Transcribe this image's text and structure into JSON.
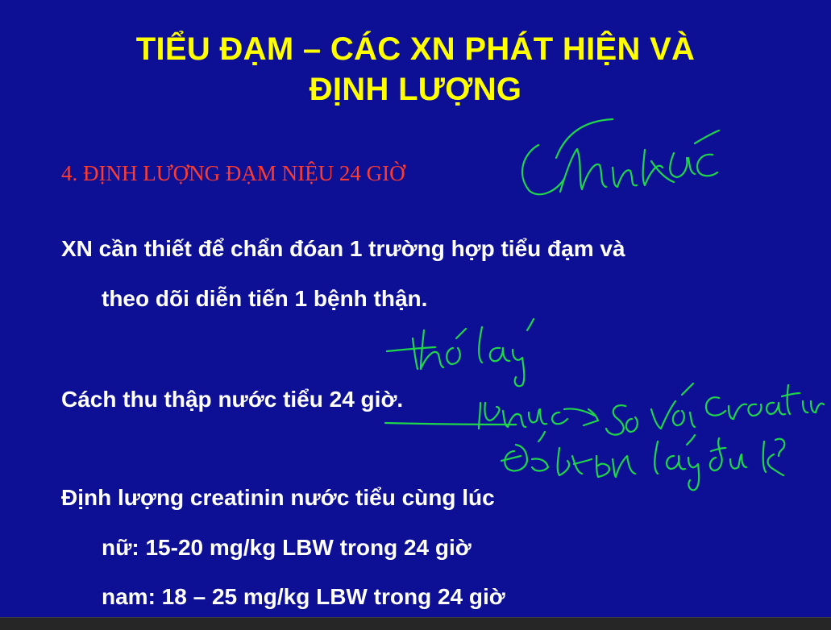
{
  "slide": {
    "title_line1": "TIỂU ĐẠM – CÁC XN PHÁT HIỆN VÀ",
    "title_line2": "ĐỊNH LƯỢNG",
    "section_heading": "4. ĐỊNH LƯỢNG ĐẠM NIỆU 24 GIỜ",
    "para1_line1": "XN cần thiết để chẩn đóan 1 trường hợp tiểu đạm và",
    "para1_line2": "theo dõi diễn tiến 1 bệnh thận.",
    "para2": "Cách thu thập nước tiểu 24 giờ.",
    "para3_line1": "Định lượng creatinin nước tiểu cùng lúc",
    "para3_line2": "nữ: 15-20 mg/kg LBW  trong 24 giờ",
    "para3_line3": "nam: 18 – 25 mg/kg LBW trong 24 giờ"
  },
  "handwriting": {
    "note1": "chính xác",
    "note2": "khó lấy",
    "note3": "khắc phục → so với creatinin",
    "note4": "để b/t BN lấy đủ k?"
  },
  "colors": {
    "background": "#0d0f95",
    "title": "#ffff00",
    "section": "#ff3b2f",
    "body": "#ffffff",
    "ink": "#1fd64a"
  }
}
